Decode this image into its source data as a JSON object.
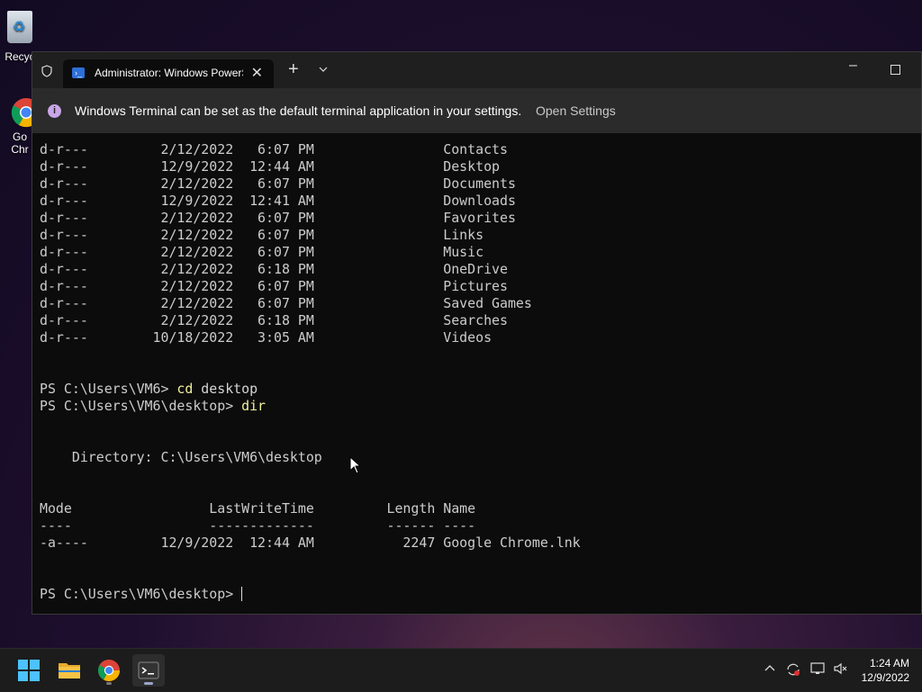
{
  "desktop": {
    "icons": [
      {
        "label": "Recyc",
        "icon": "recycle-bin-icon"
      },
      {
        "label": "Go\nChr",
        "icon": "google-chrome-icon"
      }
    ]
  },
  "window": {
    "tab_title": "Administrator: Windows PowerShell",
    "new_tab": "+",
    "dropdown": "⌄",
    "minimize": "–",
    "close_tab": "✕"
  },
  "infobar": {
    "message": "Windows Terminal can be set as the default terminal application in your settings.",
    "link": "Open Settings"
  },
  "terminal": {
    "lines": [
      "d-r---         2/12/2022   6:07 PM                Contacts",
      "d-r---         12/9/2022  12:44 AM                Desktop",
      "d-r---         2/12/2022   6:07 PM                Documents",
      "d-r---         12/9/2022  12:41 AM                Downloads",
      "d-r---         2/12/2022   6:07 PM                Favorites",
      "d-r---         2/12/2022   6:07 PM                Links",
      "d-r---         2/12/2022   6:07 PM                Music",
      "d-r---         2/12/2022   6:18 PM                OneDrive",
      "d-r---         2/12/2022   6:07 PM                Pictures",
      "d-r---         2/12/2022   6:07 PM                Saved Games",
      "d-r---         2/12/2022   6:18 PM                Searches",
      "d-r---        10/18/2022   3:05 AM                Videos",
      "",
      "",
      "",
      "",
      "",
      "    Directory: C:\\Users\\VM6\\desktop",
      "",
      "",
      "Mode                 LastWriteTime         Length Name",
      "----                 -------------         ------ ----",
      "-a----         12/9/2022  12:44 AM           2247 Google Chrome.lnk",
      "",
      "",
      ""
    ],
    "prompt1": "PS C:\\Users\\VM6> ",
    "cmd1": "cd",
    "arg1": " desktop",
    "prompt2": "PS C:\\Users\\VM6\\desktop> ",
    "cmd2": "dir",
    "prompt3": "PS C:\\Users\\VM6\\desktop> "
  },
  "taskbar": {
    "apps": [
      "start-icon",
      "file-explorer-icon",
      "google-chrome-icon",
      "windows-terminal-icon"
    ],
    "tray_icons": [
      "chevron-up-icon",
      "sync-icon",
      "network-icon",
      "speaker-muted-icon"
    ],
    "time": "1:24 AM",
    "date": "12/9/2022"
  }
}
